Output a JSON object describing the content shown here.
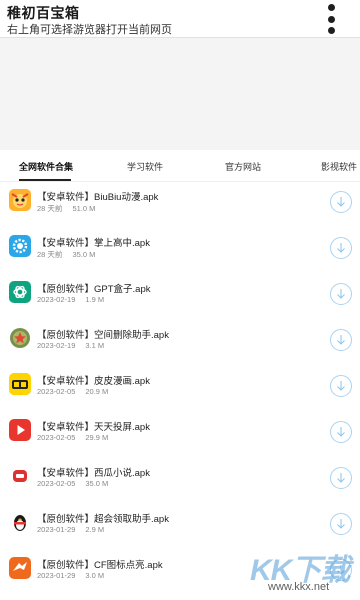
{
  "header": {
    "title": "稚初百宝箱",
    "subtitle": "右上角可选择游览器打开当前网页",
    "menu_icon": "more-vertical-icon"
  },
  "tabs": [
    {
      "label": "全网软件合集",
      "active": true
    },
    {
      "label": "学习软件",
      "active": false
    },
    {
      "label": "官方网站",
      "active": false
    },
    {
      "label": "影视软件",
      "active": false
    }
  ],
  "files": [
    {
      "name": "【安卓软件】BiuBiu动漫.apk",
      "date": "28 天前",
      "size": "51.0 M",
      "icon": "biubiu-app-icon"
    },
    {
      "name": "【安卓软件】掌上高中.apk",
      "date": "28 天前",
      "size": "35.0 M",
      "icon": "gear-app-icon"
    },
    {
      "name": "【原创软件】GPT盒子.apk",
      "date": "2023-02-19",
      "size": "1.9 M",
      "icon": "openai-icon"
    },
    {
      "name": "【原创软件】空间删除助手.apk",
      "date": "2023-02-19",
      "size": "3.1 M",
      "icon": "badge-app-icon"
    },
    {
      "name": "【安卓软件】皮皮漫画.apk",
      "date": "2023-02-05",
      "size": "20.9 M",
      "icon": "pipi-comic-icon"
    },
    {
      "name": "【安卓软件】天天投屏.apk",
      "date": "2023-02-05",
      "size": "29.9 M",
      "icon": "play-app-icon"
    },
    {
      "name": "【安卓软件】西瓜小说.apk",
      "date": "2023-02-05",
      "size": "35.0 M",
      "icon": "book-app-icon"
    },
    {
      "name": "【原创软件】超会领取助手.apk",
      "date": "2023-01-29",
      "size": "2.9 M",
      "icon": "qq-penguin-icon"
    },
    {
      "name": "【原创软件】CF图标点亮.apk",
      "date": "2023-01-29",
      "size": "3.0 M",
      "icon": "cf-app-icon"
    }
  ],
  "watermark": {
    "text": "KK下载",
    "url": "www.kkx.net"
  },
  "colors": {
    "accent": "#a9d3f2",
    "blank_area": "#f4f4f4"
  }
}
